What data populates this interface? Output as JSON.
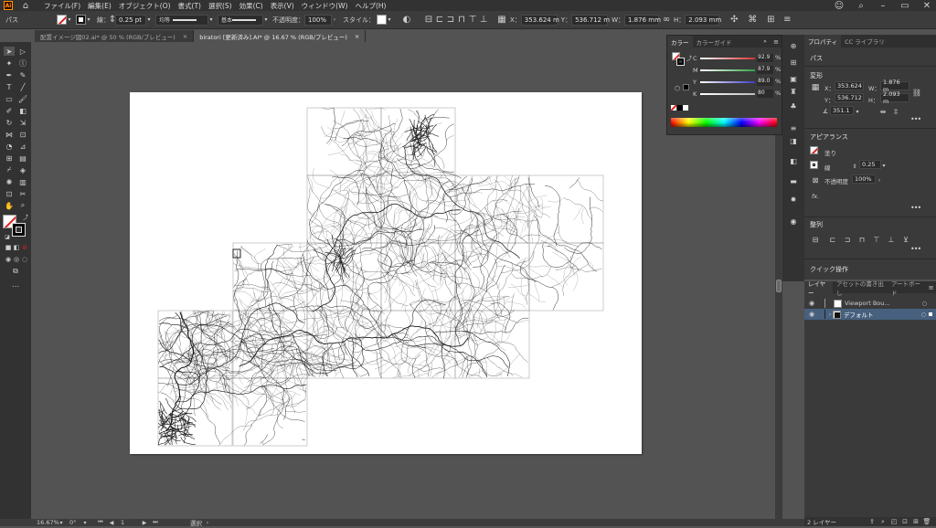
{
  "menubar": {
    "items": [
      "ファイル(F)",
      "編集(E)",
      "オブジェクト(O)",
      "書式(T)",
      "選択(S)",
      "効果(C)",
      "表示(V)",
      "ウィンドウ(W)",
      "ヘルプ(H)"
    ]
  },
  "controlbar": {
    "selection_label": "パス",
    "stroke_label": "線：",
    "stroke_weight": "0.25 pt",
    "profile_label": "均等",
    "brush_label": "基本",
    "opacity_label": "不透明度：",
    "opacity_value": "100%",
    "style_label": "スタイル：",
    "x_label": "X：",
    "x_value": "353.624 m",
    "y_label": "Y：",
    "y_value": "536.712 m",
    "w_label": "W：",
    "w_value": "1.876 mm",
    "h_label": "H：",
    "h_value": "2.093 mm"
  },
  "tabs": [
    {
      "label": "配置イメージ図02.ai* @ 50 % (RGB/プレビュー)",
      "close": "×"
    },
    {
      "label": "biratori [更新済み].AI* @ 16.67 % (RGB/プレビュー)",
      "close": "×"
    }
  ],
  "color_panel": {
    "tabs": [
      "カラー",
      "カラーガイド"
    ],
    "sliders": [
      {
        "label": "C",
        "value": "92.9",
        "unit": "%",
        "color": "#d93030"
      },
      {
        "label": "M",
        "value": "87.9",
        "unit": "%",
        "color": "#2ea34a"
      },
      {
        "label": "Y",
        "value": "89.0",
        "unit": "%",
        "color": "#3a3acb"
      },
      {
        "label": "K",
        "value": "80",
        "unit": "%",
        "color": "#bbbbbb"
      }
    ]
  },
  "properties": {
    "tabs": [
      "プロパティ",
      "CC ライブラリ"
    ],
    "selection_type": "パス",
    "transform_title": "変形",
    "x_label": "X：",
    "x_value": "353.624",
    "y_label": "Y：",
    "y_value": "536.712",
    "w_label": "W：",
    "w_value": "1.876 m",
    "h_label": "H：",
    "h_value": "2.093 m",
    "angle_value": "351.1",
    "appearance_title": "アピアランス",
    "fill_label": "塗り",
    "stroke_label": "線",
    "stroke_value": "0.25",
    "opacity_label": "不透明度",
    "opacity_value": "100%",
    "fx_label": "fx.",
    "align_title": "整列",
    "quick_actions_title": "クイック操作"
  },
  "layers": {
    "tabs": [
      "レイヤー",
      "アセットの書き出し",
      "アートボード"
    ],
    "items": [
      {
        "name": "Viewport Bou...",
        "selected": false
      },
      {
        "name": "デフォルト",
        "selected": true
      }
    ],
    "count_label": "2 レイヤー"
  },
  "statusbar": {
    "zoom": "16.67%",
    "rotation": "0°",
    "artboard": "1",
    "tool_label": "選択"
  },
  "colors": {
    "accent_selected_layer": "#46607e",
    "ui_dark": "#323232",
    "canvas_bg": "#535353",
    "logo": "#ff9a00"
  }
}
